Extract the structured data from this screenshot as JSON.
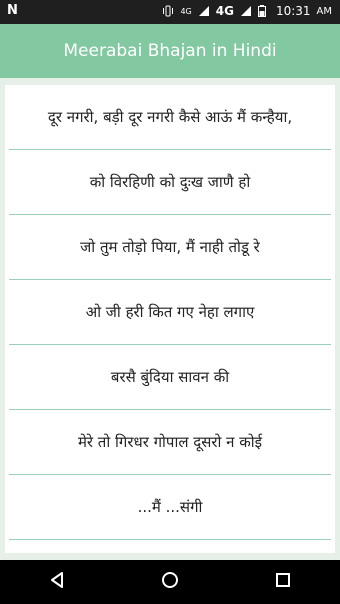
{
  "status_bar": {
    "left_logo": "N",
    "network_4g_small": "4G",
    "network_4g": "4G",
    "time": "10:31",
    "ampm": "AM"
  },
  "app_bar": {
    "title": "Meerabai Bhajan in Hindi"
  },
  "list": {
    "items": [
      {
        "label": "दूर नगरी, बड़ी दूर नगरी कैसे आऊं मैं कन्हैया,"
      },
      {
        "label": "को विरहिणी को दुःख जाणै हो"
      },
      {
        "label": "जो तुम तोड़ो पिया, मैं नाही तोडू रे"
      },
      {
        "label": "ओ जी हरी कित गए नेहा लगाए"
      },
      {
        "label": "बरसै बुंदिया सावन की"
      },
      {
        "label": "मेरे तो गिरधर गोपाल दूसरो न कोई"
      },
      {
        "label": "...मैं ...संगी"
      }
    ]
  },
  "nav_bar": {
    "back": "back-icon",
    "home": "home-icon",
    "recents": "recents-icon"
  },
  "colors": {
    "app_bar": "#82c8a0",
    "divider": "#9bd0b6",
    "background": "#e6efe8",
    "status_bar": "#1f1f1f",
    "nav_bar": "#000000"
  }
}
